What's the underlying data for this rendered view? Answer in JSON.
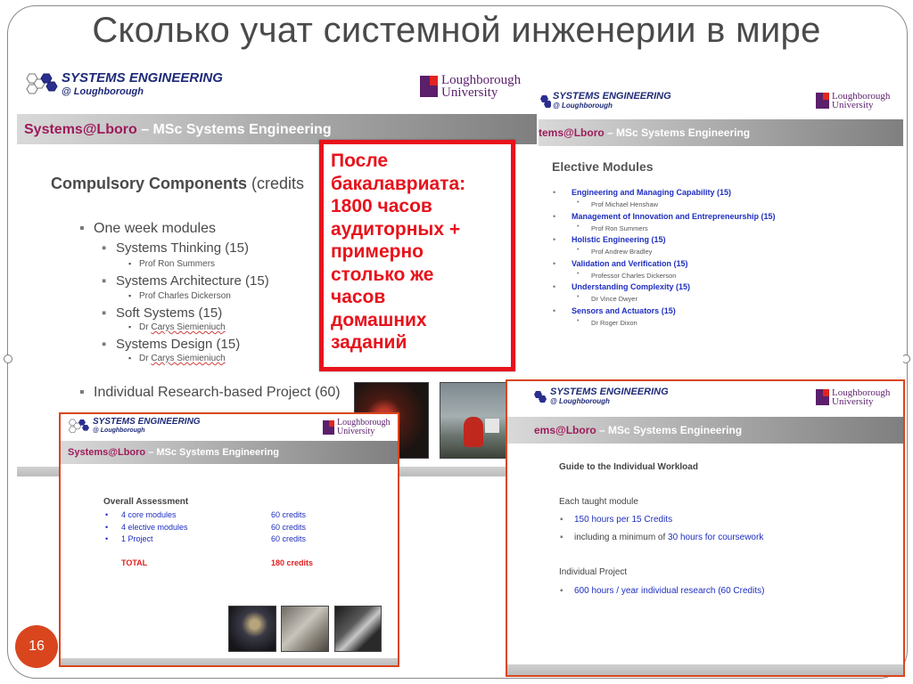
{
  "slide": {
    "title": "Сколько учат системной инженерии в мире",
    "page_number": "16"
  },
  "branding": {
    "se_title": "SYSTEMS ENGINEERING",
    "se_sub": "@ Loughborough",
    "lboro_line1": "Loughborough",
    "lboro_line2": "University",
    "banner_prefix": "Systems@Lboro",
    "banner_suffix": " – MSc Systems Engineering",
    "banner_prefix_cut": "tems@Lboro",
    "banner_prefix_cut2": "ems@Lboro"
  },
  "compulsory": {
    "heading": "Compulsory Components",
    "heading_suffix": " (credits",
    "one_week": "One week modules",
    "modules": [
      {
        "name": "Systems Thinking (15)",
        "prof": "Prof Ron Summers"
      },
      {
        "name": "Systems Architecture (15)",
        "prof": "Prof Charles Dickerson"
      },
      {
        "name": "Soft Systems (15)",
        "prof_prefix": "Dr ",
        "prof": "Carys Siemieniuch"
      },
      {
        "name": "Systems Design (15)",
        "prof_prefix": "Dr ",
        "prof": "Carys Siemieniuch"
      }
    ],
    "project": "Individual  Research-based Project (60)"
  },
  "elective": {
    "heading": "Elective Modules",
    "modules": [
      {
        "name": "Engineering and Managing Capability (15)",
        "prof": "Prof Michael Henshaw"
      },
      {
        "name": "Management of Innovation and Entrepreneurship (15)",
        "prof": "Prof Ron Summers"
      },
      {
        "name": "Holistic Engineering (15)",
        "prof": "Prof Andrew Bradley"
      },
      {
        "name": "Validation and Verification (15)",
        "prof": "Professor Charles Dickerson"
      },
      {
        "name": "Understanding Complexity (15)",
        "prof": "Dr Vince Dwyer"
      },
      {
        "name": "Sensors and Actuators (15)",
        "prof": "Dr Roger Dixon"
      }
    ]
  },
  "callout": {
    "text": "После\nбакалавриата:\n1800 часов\nаудиторных +\nпримерно\nстолько же\nчасов\nдомашних\nзаданий"
  },
  "assessment": {
    "heading": "Overall Assessment",
    "rows": [
      {
        "item": "4 core modules",
        "credits": "60 credits"
      },
      {
        "item": "4 elective modules",
        "credits": "60 credits"
      },
      {
        "item": "1 Project",
        "credits": "60 credits"
      }
    ],
    "total_label": "TOTAL",
    "total_value": "180 credits"
  },
  "workload": {
    "heading": "Guide to the Individual Workload",
    "taught": "Each taught module",
    "b1": "150 hours per 15 Credits",
    "b2_pre": "including a minimum  of ",
    "b2_hl": "30 hours for coursework",
    "project": "Individual Project",
    "b3": "600 hours / year individual research (60 Credits)"
  },
  "colors": {
    "accent_red": "#e8121b",
    "orange_border": "#d9461e",
    "navy": "#1e2a78",
    "purple": "#5b1f6b",
    "link_blue": "#1f2fbf"
  },
  "icons": [
    "hexagon-logo-icon",
    "loughborough-shield-icon",
    "square-bullet-icon"
  ]
}
